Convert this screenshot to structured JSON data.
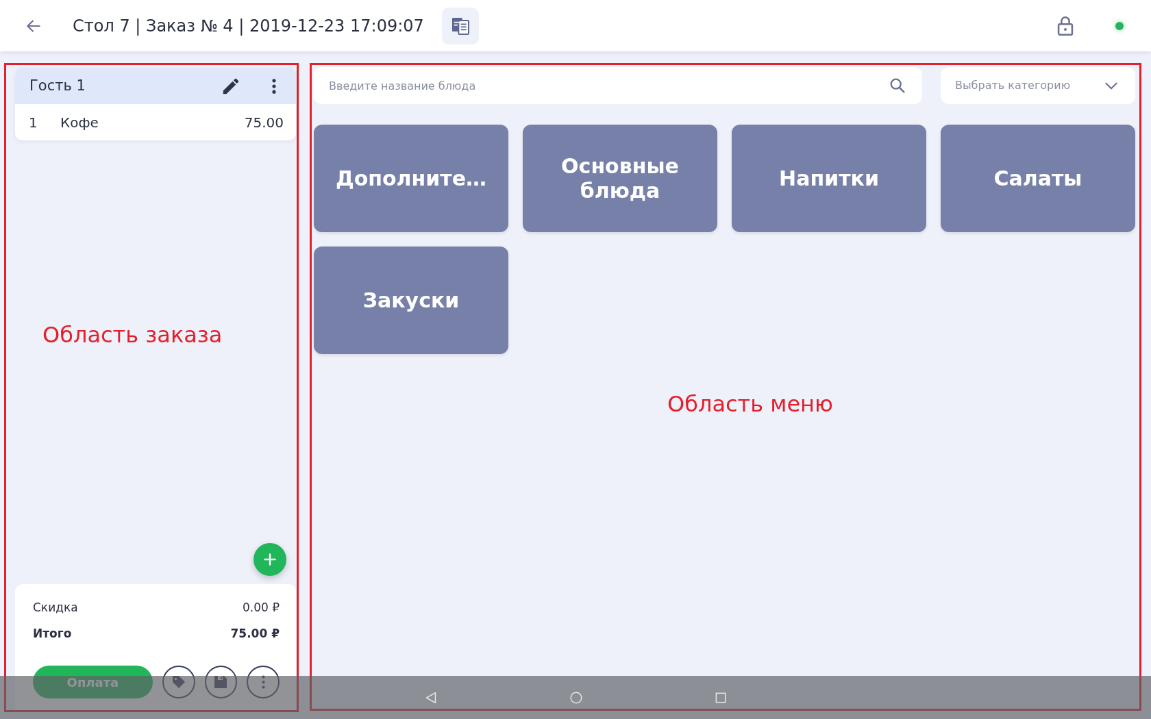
{
  "header": {
    "title": "Стол 7 | Заказ № 4 | 2019-12-23 17:09:07",
    "online": true
  },
  "order": {
    "guests": [
      {
        "name": "Гость 1",
        "items": [
          {
            "qty": "1",
            "name": "Кофе",
            "price": "75.00"
          }
        ]
      }
    ],
    "summary": [
      {
        "label": "Скидка",
        "value": "0.00 ₽",
        "kind": "normal"
      },
      {
        "label": "Итого",
        "value": "75.00 ₽",
        "kind": "total"
      }
    ],
    "pay_button": "Оплата"
  },
  "menu": {
    "search": {
      "placeholder": "Введите название блюда"
    },
    "category": {
      "placeholder": "Выбрать категорию"
    },
    "categories": [
      "Дополните…",
      "Основные блюда",
      "Напитки",
      "Салаты",
      "Закуски"
    ]
  },
  "annotations": [
    {
      "text": "Область заказа"
    },
    {
      "text": "Область меню"
    }
  ]
}
